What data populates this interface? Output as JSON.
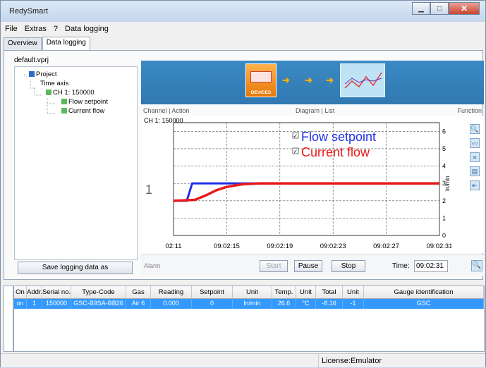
{
  "app": {
    "title": "RedySmart"
  },
  "menu": [
    "File",
    "Extras",
    "?",
    "Data logging"
  ],
  "tabs": [
    {
      "label": "Overview"
    },
    {
      "label": "Data logging"
    }
  ],
  "left": {
    "project_file": "default.vprj",
    "tree": [
      "Project",
      "Time axis",
      "CH 1: 150000",
      "Flow setpoint",
      "Current flow"
    ],
    "save_button": "Save logging data as"
  },
  "banner": {
    "devices_label": "DEVICES"
  },
  "headers": {
    "channel_action": "Channel | Action",
    "diagram_list": "Diagram | List",
    "function": "Function"
  },
  "chart_data": {
    "type": "line",
    "channel_label": "CH 1: 150000",
    "left_label": "1",
    "y_axis_label": "ln/min",
    "x_ticks": [
      "02:11",
      "09:02:15",
      "09:02:19",
      "09:02:23",
      "09:02:27",
      "09:02:31"
    ],
    "y_ticks": [
      0,
      1,
      2,
      3,
      4,
      5,
      6
    ],
    "ylim": [
      0,
      6.5
    ],
    "grid": true,
    "legend_position": "top",
    "series": [
      {
        "name": "Flow setpoint",
        "color": "#1f2fe6",
        "points": [
          [
            0,
            2
          ],
          [
            0.25,
            2
          ],
          [
            0.35,
            3
          ],
          [
            1,
            3
          ],
          [
            2,
            3
          ],
          [
            3,
            3
          ],
          [
            4,
            3
          ],
          [
            5,
            3
          ]
        ]
      },
      {
        "name": "Current flow",
        "color": "#e81a1a",
        "points": [
          [
            0,
            2
          ],
          [
            0.4,
            2.05
          ],
          [
            0.6,
            2.3
          ],
          [
            0.8,
            2.6
          ],
          [
            1.0,
            2.8
          ],
          [
            1.3,
            2.95
          ],
          [
            1.6,
            3
          ],
          [
            2,
            3
          ],
          [
            3,
            3
          ],
          [
            4,
            3
          ],
          [
            5,
            3
          ]
        ]
      }
    ]
  },
  "controls": {
    "alarm": "Alarm",
    "start": "Start",
    "pause": "Pause",
    "stop": "Stop",
    "time_label": "Time:",
    "time_value": "09:02:31"
  },
  "table": {
    "headers": [
      "On",
      "Addr.",
      "Serial no.",
      "Type-Code",
      "Gas",
      "Reading",
      "Setpoint",
      "Unit",
      "Temp.",
      "Unit",
      "Total",
      "Unit",
      "Gauge identification"
    ],
    "rows": [
      [
        "on",
        "1",
        "150000",
        "GSC-B9SA-BB26",
        "Air 6",
        "0.000",
        "0",
        "ln/min",
        "26.6",
        "°C",
        "-8.16",
        "-1",
        "GSC"
      ]
    ]
  },
  "status": {
    "license": "License:Emulator"
  }
}
